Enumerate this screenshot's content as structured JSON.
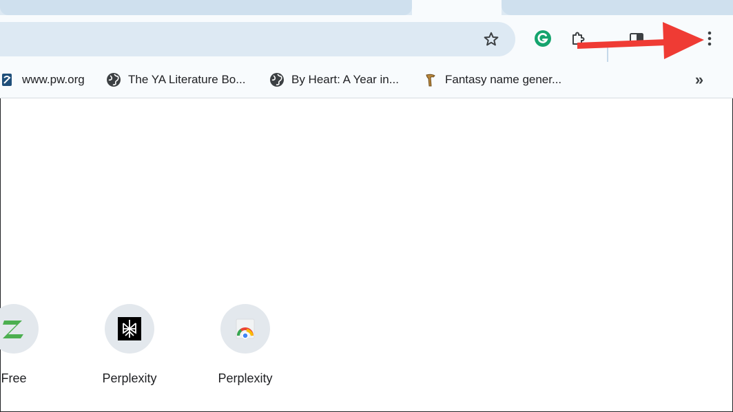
{
  "colors": {
    "tabstrip": "#dde9f3",
    "toolbar": "#f8fbfd",
    "omnibox": "#dde9f3",
    "annotation_arrow": "#ef3b34",
    "grammarly_green": "#15a46e"
  },
  "toolbar": {
    "bookmark_star_icon": "star-icon",
    "grammarly_icon": "grammarly-icon",
    "extensions_icon": "puzzle-icon",
    "side_panel_icon": "side-panel-icon",
    "menu_icon": "kebab-menu-icon"
  },
  "bookmarks": {
    "items": [
      {
        "label": "www.pw.org",
        "icon": "pw-org-favicon"
      },
      {
        "label": "The YA Literature Bo...",
        "icon": "globe-icon"
      },
      {
        "label": "By Heart: A Year in...",
        "icon": "globe-icon"
      },
      {
        "label": "Fantasy name gener...",
        "icon": "fantasy-favicon"
      }
    ],
    "overflow_label": "»"
  },
  "shortcuts": [
    {
      "label": "Free",
      "icon": "zoho-z-icon"
    },
    {
      "label": "Perplexity",
      "icon": "perplexity-icon"
    },
    {
      "label": "Perplexity",
      "icon": "chrome-default-icon"
    }
  ]
}
